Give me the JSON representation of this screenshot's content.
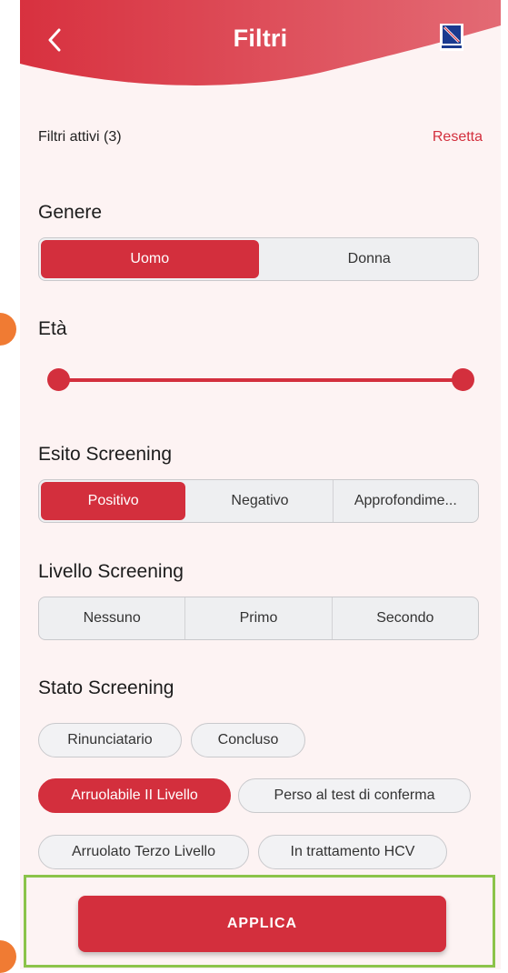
{
  "header": {
    "title": "Filtri",
    "back_icon": "chevron-left-icon",
    "logo_icon": "regione-campania-logo"
  },
  "filters": {
    "active_label": "Filtri attivi (3)",
    "reset_label": "Resetta"
  },
  "genere": {
    "title": "Genere",
    "options": [
      "Uomo",
      "Donna"
    ],
    "selected": "Uomo"
  },
  "eta": {
    "title": "Età",
    "range": [
      0,
      1
    ]
  },
  "esito": {
    "title": "Esito Screening",
    "options": [
      "Positivo",
      "Negativo",
      "Approfondime..."
    ],
    "selected": "Positivo"
  },
  "livello": {
    "title": "Livello Screening",
    "options": [
      "Nessuno",
      "Primo",
      "Secondo"
    ]
  },
  "stato": {
    "title": "Stato Screening",
    "chips": [
      "Rinunciatario",
      "Concluso",
      "Arruolabile II Livello",
      "Perso al test di conferma",
      "Arruolato Terzo Livello",
      "In trattamento HCV"
    ],
    "selected": "Arruolabile II Livello"
  },
  "apply": {
    "label": "APPLICA"
  },
  "colors": {
    "accent": "#d32f3d",
    "highlight_border": "#8bc34a",
    "marker": "#f07b33"
  }
}
